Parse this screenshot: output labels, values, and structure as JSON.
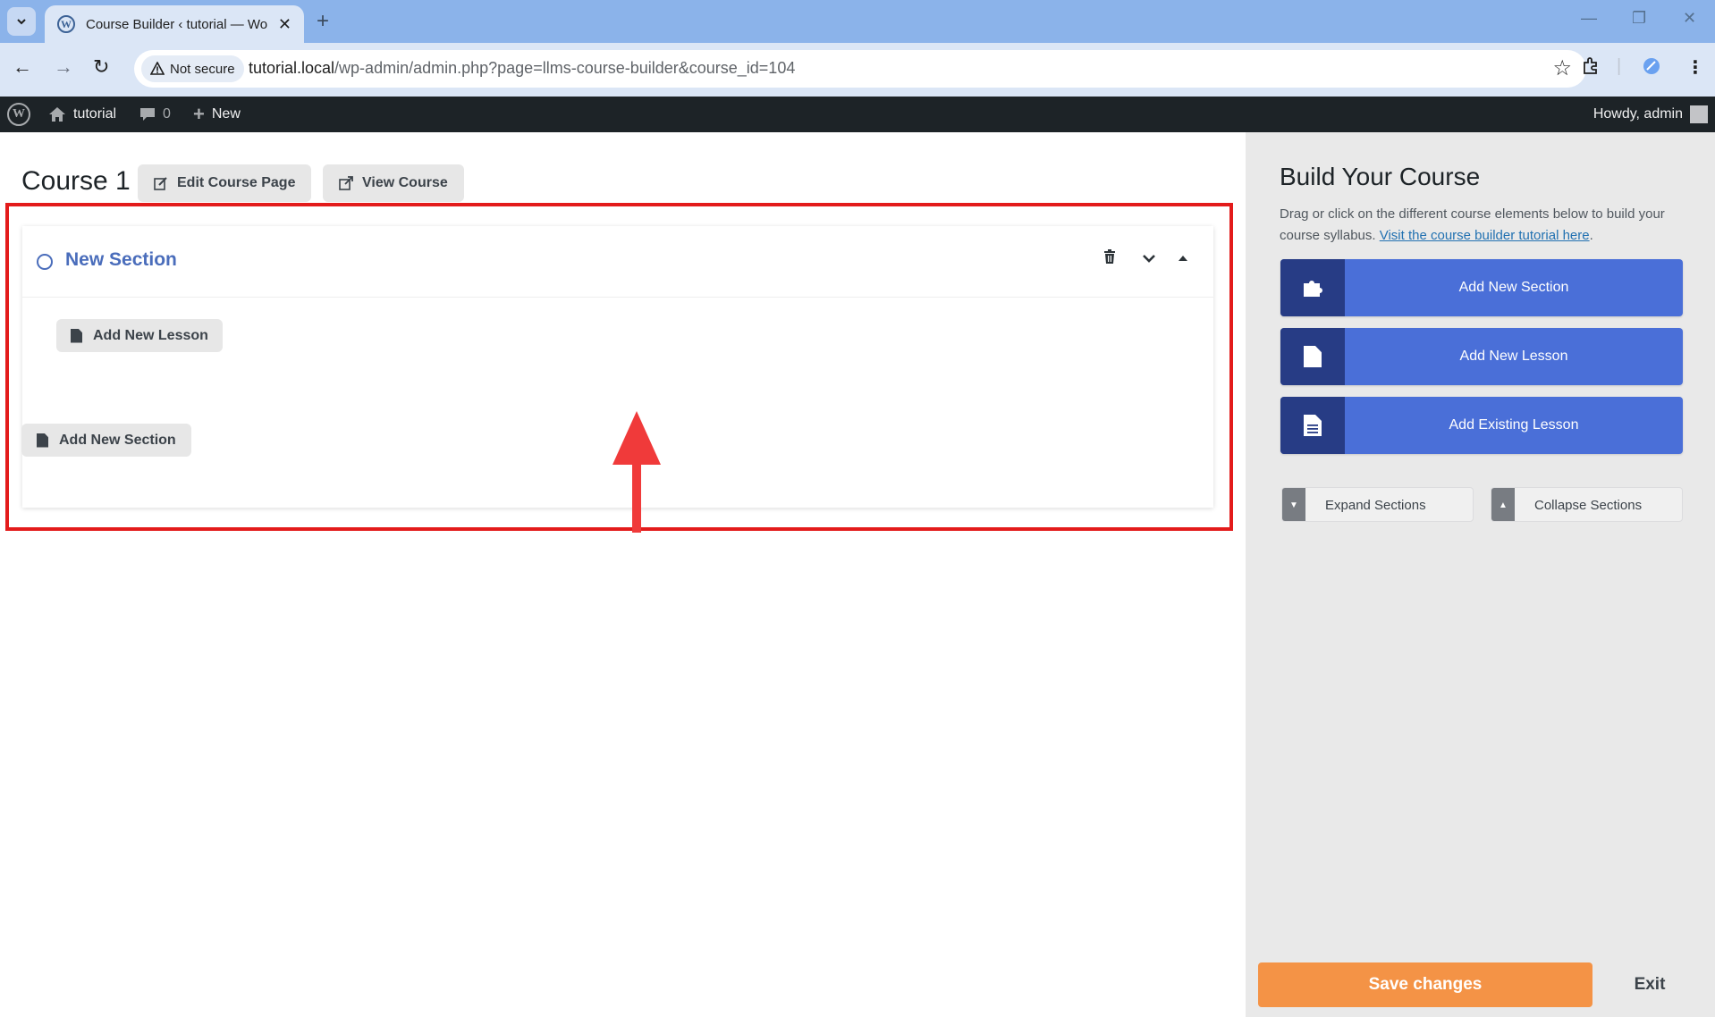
{
  "browser": {
    "tab_title": "Course Builder ‹ tutorial — Wo",
    "security_label": "Not secure",
    "url_host": "tutorial.local",
    "url_path": "/wp-admin/admin.php?page=llms-course-builder&course_id=104"
  },
  "adminbar": {
    "site_name": "tutorial",
    "comments_count": "0",
    "new_label": "New",
    "greeting": "Howdy, admin"
  },
  "main": {
    "course_title": "Course 1",
    "edit_course_label": "Edit Course Page",
    "view_course_label": "View Course",
    "section": {
      "title": "New Section",
      "add_lesson_label": "Add New Lesson"
    },
    "add_section_label": "Add New Section"
  },
  "sidebar": {
    "title": "Build Your Course",
    "description": "Drag or click on the different course elements below to build your course syllabus.",
    "tutorial_link": "Visit the course builder tutorial here",
    "buttons": [
      {
        "label": "Add New Section",
        "icon": "puzzle-icon"
      },
      {
        "label": "Add New Lesson",
        "icon": "document-icon"
      },
      {
        "label": "Add Existing Lesson",
        "icon": "document-lines-icon"
      }
    ],
    "expand_label": "Expand Sections",
    "collapse_label": "Collapse Sections",
    "save_label": "Save changes",
    "exit_label": "Exit"
  },
  "colors": {
    "highlight": "#e31b1b",
    "primary_button": "#4a6fd8",
    "primary_icon_bg": "#273c85",
    "save_button": "#f49346",
    "section_title": "#4a6dbb",
    "admin_bar": "#1d2327"
  }
}
